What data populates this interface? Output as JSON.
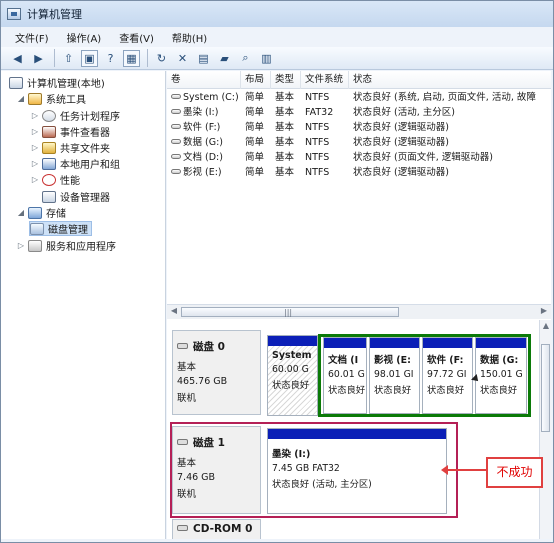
{
  "window": {
    "title": "计算机管理"
  },
  "menu": {
    "items": [
      "文件(F)",
      "操作(A)",
      "查看(V)",
      "帮助(H)"
    ]
  },
  "toolbar": {
    "buttons": [
      "back-icon",
      "forward-icon",
      "up-icon",
      "folder-icon",
      "help-icon",
      "split-view-icon",
      "refresh-icon",
      "delete-icon",
      "properties-icon",
      "open-icon",
      "search-icon",
      "export-icon"
    ]
  },
  "tree": {
    "root": "计算机管理(本地)",
    "system_tools": "系统工具",
    "task_scheduler": "任务计划程序",
    "event_viewer": "事件查看器",
    "shared_folders": "共享文件夹",
    "local_users": "本地用户和组",
    "performance": "性能",
    "device_manager": "设备管理器",
    "storage": "存储",
    "disk_management": "磁盘管理",
    "services_apps": "服务和应用程序"
  },
  "volume_table": {
    "headers": [
      "卷",
      "布局",
      "类型",
      "文件系统",
      "状态"
    ],
    "rows": [
      [
        "System (C:)",
        "简单",
        "基本",
        "NTFS",
        "状态良好 (系统, 启动, 页面文件, 活动, 故障"
      ],
      [
        "墨染 (I:)",
        "简单",
        "基本",
        "FAT32",
        "状态良好 (活动, 主分区)"
      ],
      [
        "软件 (F:)",
        "简单",
        "基本",
        "NTFS",
        "状态良好 (逻辑驱动器)"
      ],
      [
        "数据 (G:)",
        "简单",
        "基本",
        "NTFS",
        "状态良好 (逻辑驱动器)"
      ],
      [
        "文档 (D:)",
        "简单",
        "基本",
        "NTFS",
        "状态良好 (页面文件, 逻辑驱动器)"
      ],
      [
        "影视 (E:)",
        "简单",
        "基本",
        "NTFS",
        "状态良好 (逻辑驱动器)"
      ]
    ],
    "scroll_grip": "|||"
  },
  "disks": [
    {
      "name": "磁盘 0",
      "type": "基本",
      "size": "465.76 GB",
      "status": "联机",
      "partitions": [
        {
          "name": "System",
          "size": "60.00 G",
          "status": "状态良好"
        },
        {
          "name": "文档 (I",
          "size": "60.01 G",
          "status": "状态良好"
        },
        {
          "name": "影视 (E:",
          "size": "98.01 GI",
          "status": "状态良好"
        },
        {
          "name": "软件 (F:",
          "size": "97.72 GI",
          "status": "状态良好"
        },
        {
          "name": "数据 (G:",
          "size": "150.01 G",
          "status": "状态良好"
        }
      ]
    },
    {
      "name": "磁盘 1",
      "type": "基本",
      "size": "7.46 GB",
      "status": "联机",
      "partition": {
        "name": "墨染 (I:)",
        "size_fs": "7.45 GB FAT32",
        "status": "状态良好 (活动, 主分区)"
      }
    },
    {
      "name": "CD-ROM 0"
    }
  ],
  "annotation": {
    "failure_label": "不成功",
    "red_color": "#e04040",
    "green_color": "#0b7a08"
  }
}
